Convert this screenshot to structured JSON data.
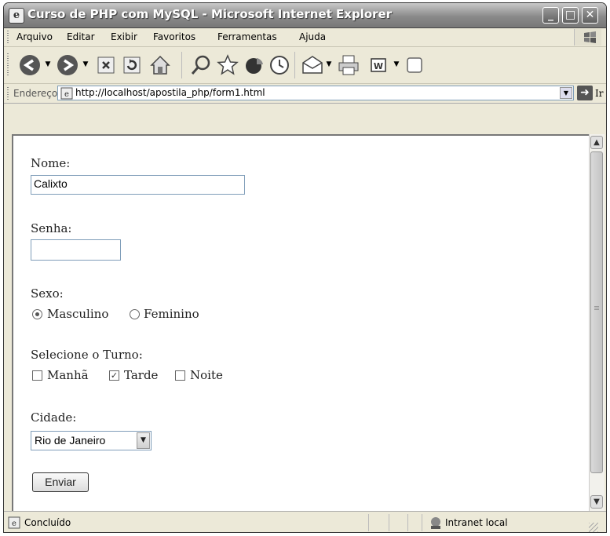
{
  "window": {
    "title": "Curso de PHP com MySQL - Microsoft Internet Explorer",
    "minimize_glyph": "_",
    "maximize_glyph": "□",
    "close_glyph": "✕"
  },
  "menu": [
    "Arquivo",
    "Editar",
    "Exibir",
    "Favoritos",
    "Ferramentas",
    "Ajuda"
  ],
  "toolbar": {
    "icons": [
      "back-icon",
      "forward-icon",
      "stop-icon",
      "refresh-icon",
      "home-icon",
      "search-icon",
      "favorites-icon",
      "media-icon",
      "history-icon",
      "mail-icon",
      "print-icon",
      "word-icon",
      "page-icon"
    ]
  },
  "address": {
    "label": "Endereço",
    "url": "http://localhost/apostila_php/form1.html",
    "go_label": "Ir"
  },
  "form": {
    "nome_label": "Nome:",
    "nome_value": "Calixto",
    "senha_label": "Senha:",
    "senha_value": "",
    "sexo_label": "Sexo:",
    "sexo_options": [
      "Masculino",
      "Feminino"
    ],
    "sexo_selected": "Masculino",
    "turno_label": "Selecione o Turno:",
    "turno_options": [
      "Manhã",
      "Tarde",
      "Noite"
    ],
    "turno_checked": [
      "Tarde"
    ],
    "cidade_label": "Cidade:",
    "cidade_value": "Rio de Janeiro",
    "submit_label": "Enviar"
  },
  "status": {
    "text": "Concluído",
    "zone": "Intranet local"
  }
}
